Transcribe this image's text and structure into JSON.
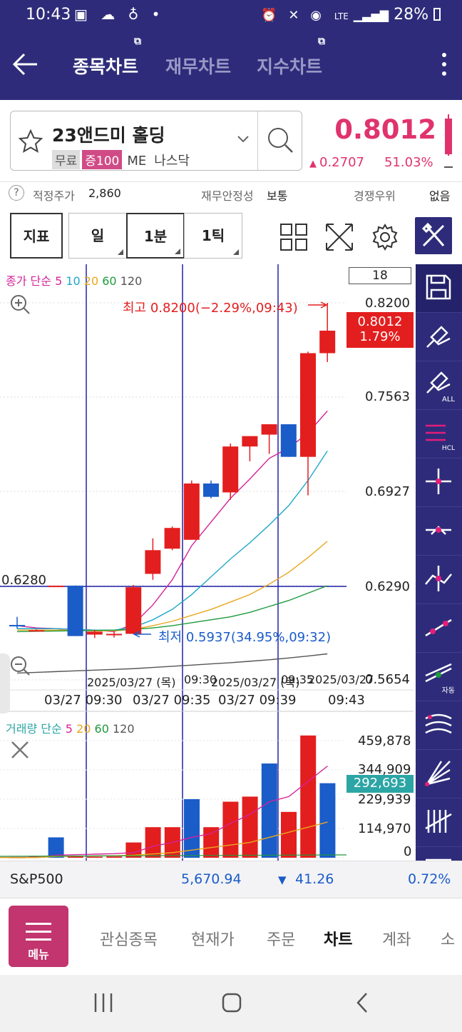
{
  "status": {
    "time": "10:43",
    "battery": "28%",
    "net": "LTE"
  },
  "appbar": {
    "tabs": [
      {
        "label": "종목차트"
      },
      {
        "label": "재무차트"
      },
      {
        "label": "지수차트"
      }
    ]
  },
  "stock": {
    "name": "23앤드미 홀딩",
    "badges": [
      "무료",
      "증100",
      "ME",
      "나스닥"
    ],
    "price": "0.8012",
    "change": "0.2707",
    "change_pct": "51.03%"
  },
  "info": {
    "fair_label": "적정주가",
    "fair_value": "2,860",
    "fin_label": "재무안정성",
    "fin_value": "보통",
    "comp_label": "경쟁우위",
    "comp_value": "없음"
  },
  "toolbar": {
    "indicator": "지표",
    "periods": [
      "일",
      "1분",
      "1틱"
    ],
    "count": "18"
  },
  "legend": {
    "price_title": "종가 단순",
    "price_ma": [
      "5",
      "10",
      "20",
      "60",
      "120"
    ],
    "volume_title": "거래량 단순",
    "volume_ma": [
      "5",
      "20",
      "60",
      "120"
    ]
  },
  "colors": {
    "up": "#e31e1e",
    "down": "#1a5cc8",
    "ma5": "#d4239a",
    "ma10": "#20a8c8",
    "ma20": "#e8a81e",
    "ma60": "#1e9a3c",
    "ma120": "#555555",
    "accent": "#2e2c7a"
  },
  "chart_data": {
    "type": "candlestick",
    "y_ticks": [
      "0.8200",
      "0.7563",
      "0.6927",
      "0.6290",
      "0.5654"
    ],
    "ylim": [
      0.5654,
      0.82
    ],
    "last_price_tag": "0.8012",
    "last_pct_tag": "1.79%",
    "crosshair_price": "0.6280",
    "high_annotation": "최고 0.8200(−2.29%,09:43)",
    "low_annotation": "최저 0.5937(34.95%,09:32)",
    "x_top_labels": [
      "2025/03/27 (목)",
      "2025/03/27 (목)",
      "2025/03/27"
    ],
    "x_top_times": [
      "09:30",
      "09:35"
    ],
    "x_labels": [
      "03/27 09:30",
      "03/27 09:35",
      "03/27 09:39",
      "09:43"
    ],
    "candles": [
      {
        "o": 0.6025,
        "h": 0.608,
        "l": 0.6,
        "c": 0.602
      },
      {
        "o": 0.599,
        "h": 0.5995,
        "l": 0.5985,
        "c": 0.599
      },
      {
        "o": 0.629,
        "h": 0.629,
        "l": 0.629,
        "c": 0.629
      },
      {
        "o": 0.629,
        "h": 0.6292,
        "l": 0.595,
        "c": 0.595
      },
      {
        "o": 0.596,
        "h": 0.599,
        "l": 0.5937,
        "c": 0.598
      },
      {
        "o": 0.596,
        "h": 0.598,
        "l": 0.594,
        "c": 0.5965
      },
      {
        "o": 0.5965,
        "h": 0.6295,
        "l": 0.5965,
        "c": 0.628
      },
      {
        "o": 0.637,
        "h": 0.661,
        "l": 0.633,
        "c": 0.653
      },
      {
        "o": 0.654,
        "h": 0.669,
        "l": 0.653,
        "c": 0.668
      },
      {
        "o": 0.66,
        "h": 0.7,
        "l": 0.66,
        "c": 0.698
      },
      {
        "o": 0.698,
        "h": 0.7,
        "l": 0.688,
        "c": 0.689
      },
      {
        "o": 0.692,
        "h": 0.725,
        "l": 0.687,
        "c": 0.723
      },
      {
        "o": 0.723,
        "h": 0.73,
        "l": 0.713,
        "c": 0.73
      },
      {
        "o": 0.731,
        "h": 0.738,
        "l": 0.718,
        "c": 0.738
      },
      {
        "o": 0.738,
        "h": 0.738,
        "l": 0.716,
        "c": 0.716
      },
      {
        "o": 0.716,
        "h": 0.787,
        "l": 0.69,
        "c": 0.786
      },
      {
        "o": 0.786,
        "h": 0.82,
        "l": 0.78,
        "c": 0.8012
      }
    ],
    "ma": {
      "ma5": [
        0.602,
        0.6005,
        0.6,
        0.5995,
        0.599,
        0.598,
        0.603,
        0.616,
        0.633,
        0.656,
        0.672,
        0.688,
        0.701,
        0.715,
        0.722,
        0.732,
        0.747
      ],
      "ma10": [
        0.6,
        0.6,
        0.6,
        0.5995,
        0.599,
        0.599,
        0.601,
        0.606,
        0.613,
        0.623,
        0.635,
        0.647,
        0.658,
        0.67,
        0.683,
        0.7,
        0.72
      ],
      "ma20": [
        0.599,
        0.599,
        0.599,
        0.599,
        0.5985,
        0.5985,
        0.5995,
        0.602,
        0.605,
        0.609,
        0.613,
        0.618,
        0.623,
        0.63,
        0.638,
        0.648,
        0.659
      ],
      "ma60": [
        0.598,
        0.5982,
        0.5984,
        0.5986,
        0.5988,
        0.599,
        0.5995,
        0.6005,
        0.602,
        0.604,
        0.606,
        0.608,
        0.611,
        0.615,
        0.619,
        0.624,
        0.629
      ],
      "ma120": [
        0.57,
        0.5705,
        0.571,
        0.5715,
        0.572,
        0.5725,
        0.573,
        0.5738,
        0.5746,
        0.5754,
        0.5762,
        0.577,
        0.578,
        0.579,
        0.5802,
        0.5815,
        0.583
      ]
    },
    "volume": {
      "y_ticks": [
        "459,878",
        "344,909",
        "229,939",
        "114,970",
        "0"
      ],
      "ylim": [
        0,
        459878
      ],
      "last_tag": "292,693",
      "bars": [
        2000,
        1000,
        5000,
        80000,
        6000,
        4000,
        5000,
        60000,
        120000,
        120000,
        230000,
        120000,
        220000,
        240000,
        370000,
        180000,
        480000,
        292693
      ],
      "ma5": [
        1000,
        1500,
        2000,
        10000,
        12000,
        14000,
        16000,
        20000,
        45000,
        60000,
        80000,
        95000,
        135000,
        170000,
        220000,
        240000,
        300000,
        360000
      ],
      "ma20": [
        500,
        600,
        700,
        5000,
        6000,
        7000,
        8000,
        10000,
        15000,
        20000,
        30000,
        40000,
        50000,
        60000,
        80000,
        100000,
        120000,
        140000
      ]
    }
  },
  "indexbar": {
    "name": "S&P500",
    "value": "5,670.94",
    "change": "41.26",
    "pct": "0.72%"
  },
  "bottom_menu": {
    "menu": "메뉴",
    "items": [
      "관심종목",
      "현재가",
      "주문",
      "차트",
      "계좌",
      "소"
    ]
  },
  "drawing_tools": {
    "all_label": "ALL",
    "hcl_label": "HCL",
    "auto_label": "자동"
  }
}
